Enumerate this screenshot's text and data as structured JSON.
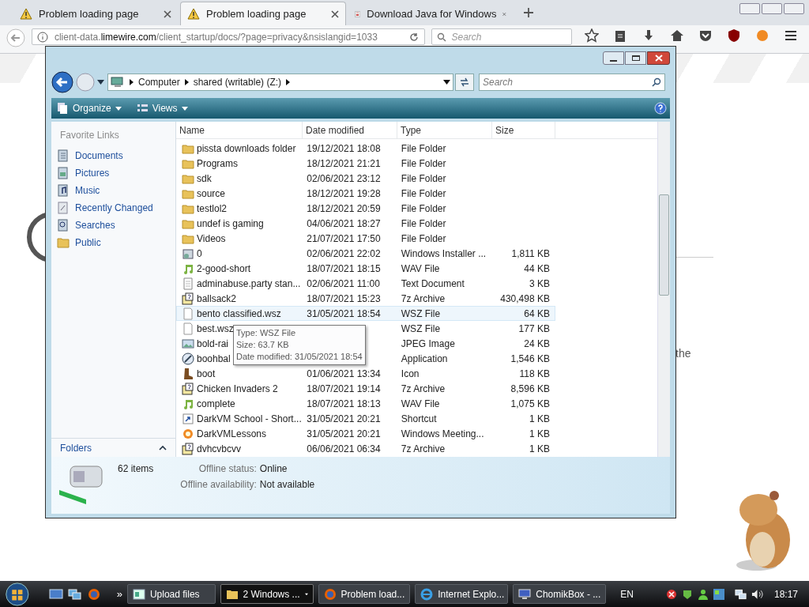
{
  "browser": {
    "tabs": [
      {
        "title": "Problem loading page",
        "kind": "warning",
        "selected": false
      },
      {
        "title": "Problem loading page",
        "kind": "warning",
        "selected": true
      },
      {
        "title": "Download Java for Windows",
        "kind": "java",
        "selected": false
      }
    ],
    "url": {
      "prefix": "client-data.",
      "domain": "limewire.com",
      "path": "/client_startup/docs/?page=privacy&nsislangid=1033"
    },
    "search_placeholder": "Search",
    "page_text": "the"
  },
  "explorer": {
    "breadcrumb": [
      "Computer",
      "shared (writable) (Z:)"
    ],
    "search_placeholder": "Search",
    "toolbar": [
      "Organize",
      "Views"
    ],
    "favorites_title": "Favorite Links",
    "favorites": [
      {
        "label": "Documents",
        "kind": "documents"
      },
      {
        "label": "Pictures",
        "kind": "pictures"
      },
      {
        "label": "Music",
        "kind": "music"
      },
      {
        "label": "Recently Changed",
        "kind": "recent"
      },
      {
        "label": "Searches",
        "kind": "searches"
      },
      {
        "label": "Public",
        "kind": "folder"
      }
    ],
    "folders_label": "Folders",
    "columns": [
      "Name",
      "Date modified",
      "Type",
      "Size"
    ],
    "rows": [
      {
        "name": "pissta downloads folder",
        "date": "19/12/2021 18:08",
        "type": "File Folder",
        "kind": "folder",
        "hovered": false
      },
      {
        "name": "Programs",
        "date": "18/12/2021 21:21",
        "type": "File Folder",
        "kind": "folder",
        "hovered": false
      },
      {
        "name": "sdk",
        "date": "02/06/2021 23:12",
        "type": "File Folder",
        "kind": "folder",
        "hovered": false
      },
      {
        "name": "source",
        "date": "18/12/2021 19:28",
        "type": "File Folder",
        "kind": "folder",
        "hovered": false
      },
      {
        "name": "testlol2",
        "date": "18/12/2021 20:59",
        "type": "File Folder",
        "kind": "folder",
        "hovered": false
      },
      {
        "name": "undef is gaming",
        "date": "04/06/2021 18:27",
        "type": "File Folder",
        "kind": "folder",
        "hovered": false
      },
      {
        "name": "Videos",
        "date": "21/07/2021 17:50",
        "type": "File Folder",
        "kind": "folder",
        "hovered": false
      },
      {
        "name": "0",
        "date": "02/06/2021 22:02",
        "type": "Windows Installer ...",
        "size": "1,811 KB",
        "kind": "installer",
        "hovered": false
      },
      {
        "name": "2-good-short",
        "date": "18/07/2021 18:15",
        "type": "WAV File",
        "size": "44 KB",
        "kind": "audio",
        "hovered": false
      },
      {
        "name": "adminabuse.party stan...",
        "date": "02/06/2021 11:00",
        "type": "Text Document",
        "size": "3 KB",
        "kind": "text",
        "hovered": false
      },
      {
        "name": "ballsack2",
        "date": "18/07/2021 15:23",
        "type": "7z Archive",
        "size": "430,498 KB",
        "kind": "archive",
        "hovered": false
      },
      {
        "name": "bento classified.wsz",
        "date": "31/05/2021 18:54",
        "type": "WSZ File",
        "size": "64 KB",
        "kind": "file",
        "hovered": true
      },
      {
        "name": "best.wsz",
        "type": "WSZ File",
        "size": "177 KB",
        "kind": "file",
        "hovered": false
      },
      {
        "name": "bold-rai",
        "type": "JPEG Image",
        "size": "24 KB",
        "kind": "image",
        "hovered": false
      },
      {
        "name": "boohbal",
        "type": "Application",
        "size": "1,546 KB",
        "kind": "app",
        "hovered": false
      },
      {
        "name": "boot",
        "date": "01/06/2021 13:34",
        "type": "Icon",
        "size": "118 KB",
        "kind": "boot",
        "hovered": false
      },
      {
        "name": "Chicken Invaders 2",
        "date": "18/07/2021 19:14",
        "type": "7z Archive",
        "size": "8,596 KB",
        "kind": "archive",
        "hovered": false
      },
      {
        "name": "complete",
        "date": "18/07/2021 18:13",
        "type": "WAV File",
        "size": "1,075 KB",
        "kind": "audio",
        "hovered": false
      },
      {
        "name": "DarkVM School - Short...",
        "date": "31/05/2021 20:21",
        "type": "Shortcut",
        "size": "1 KB",
        "kind": "shortcut",
        "hovered": false
      },
      {
        "name": "DarkVMLessons",
        "date": "31/05/2021 20:21",
        "type": "Windows Meeting...",
        "size": "1 KB",
        "kind": "meeting",
        "hovered": false
      },
      {
        "name": "dvhcvbcvv",
        "date": "06/06/2021 06:34",
        "type": "7z Archive",
        "size": "1 KB",
        "kind": "archive",
        "hovered": false
      }
    ],
    "tooltip": [
      "Type: WSZ File",
      "Size: 63.7 KB",
      "Date modified: 31/05/2021 18:54"
    ],
    "details": {
      "count": "62 items",
      "fields": [
        {
          "label": "Offline status:",
          "value": "Online"
        },
        {
          "label": "Offline availability:",
          "value": "Not available"
        }
      ]
    }
  },
  "taskbar": {
    "buttons": [
      {
        "label": "Upload files",
        "kind": "window",
        "selected": false
      },
      {
        "label": "2 Windows ...",
        "kind": "folder",
        "selected": true
      },
      {
        "label": "Problem load...",
        "kind": "firefox",
        "selected": false
      },
      {
        "label": "Internet Explo...",
        "kind": "ie",
        "selected": false
      },
      {
        "label": "ChomikBox - ...",
        "kind": "monitor",
        "selected": false
      }
    ],
    "language": "EN",
    "clock": "18:17",
    "overflow": "»"
  }
}
